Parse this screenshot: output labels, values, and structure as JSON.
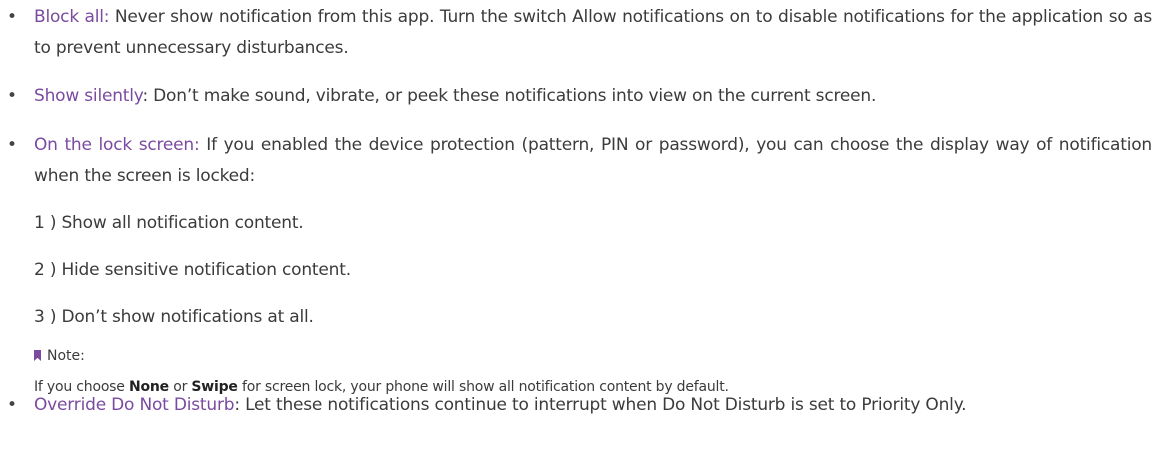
{
  "items": [
    {
      "term": "Block all:",
      "text": " Never show notification from this app. Turn the switch Allow notifications on to disable notifications for the application so as to prevent unnecessary disturbances."
    },
    {
      "term": "Show silently",
      "text": ": Don’t make sound, vibrate, or peek these notifications into view on the current screen."
    },
    {
      "term": "On the lock screen:",
      "text": " If you enabled the device protection (pattern, PIN or password), you can choose the display way of notification when the screen is locked:",
      "options": [
        "1 ) Show all notification content.",
        "2 ) Hide sensitive notification content.",
        "3 ) Don’t show notifications at all."
      ],
      "note": {
        "label": "Note:",
        "prefix": "If you choose ",
        "none": "None",
        "or": " or ",
        "swipe": "Swipe",
        "suffix": " for screen lock, your phone will show all notification content by default."
      }
    },
    {
      "term": "Override Do Not Disturb",
      "text": ": Let these notifications continue to interrupt when Do Not Disturb is set to Priority Only."
    }
  ],
  "bullet_symbol": "•",
  "colors": {
    "term": "#7a4aa0",
    "text": "#3b3b3b"
  }
}
